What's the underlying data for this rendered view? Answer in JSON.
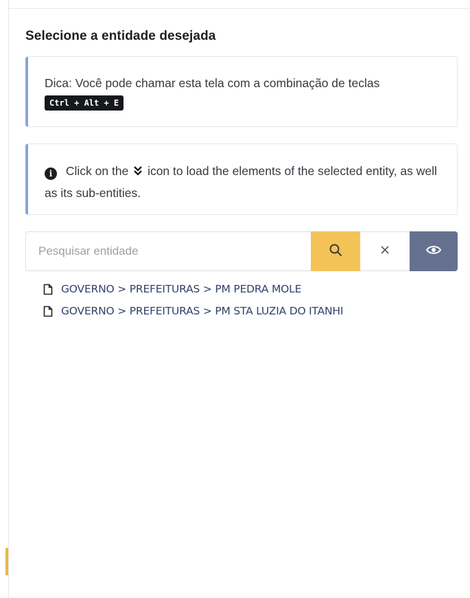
{
  "panel": {
    "title": "Selecione a entidade desejada"
  },
  "hint": {
    "text": "Dica: Você pode chamar esta tela com a combinação de teclas",
    "shortcut": "Ctrl + Alt + E"
  },
  "info": {
    "text_before": "Click on the",
    "text_after": "icon to load the elements of the selected entity, as well as its sub-entities.",
    "icon": "info-circle-icon",
    "inline_icon": "double-chevron-down-icon"
  },
  "search": {
    "placeholder": "Pesquisar entidade",
    "value": "",
    "search_icon": "search-icon",
    "clear_icon": "close-icon",
    "view_icon": "eye-icon"
  },
  "results": [
    {
      "icon": "file-icon",
      "label": "GOVERNO > PREFEITURAS > PM PEDRA MOLE"
    },
    {
      "icon": "file-icon",
      "label": "GOVERNO > PREFEITURAS > PM STA LUZIA DO ITANHI"
    }
  ],
  "colors": {
    "callout_border": "#8aa4d6",
    "search_button": "#f4c358",
    "view_button": "#66718f",
    "result_text": "#33416b"
  }
}
